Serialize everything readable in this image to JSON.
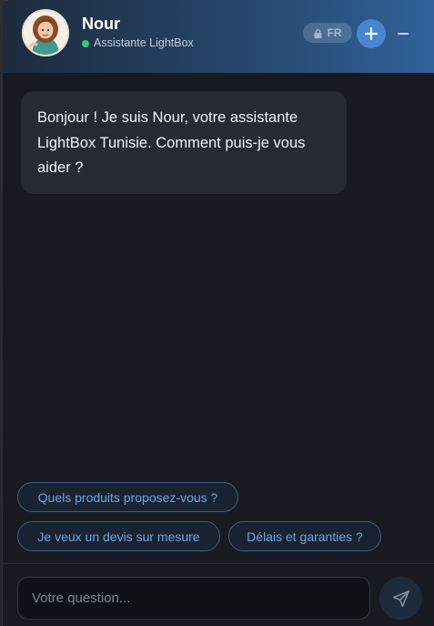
{
  "header": {
    "agent_name": "Nour",
    "agent_subtitle": "Assistante LightBox",
    "status_color": "#2ecc71",
    "language_badge": "FR",
    "new_chat_icon": "plus-icon",
    "minimize_icon": "minus-icon"
  },
  "messages": [
    {
      "sender": "bot",
      "text": "Bonjour ! Je suis Nour, votre assistante LightBox Tunisie. Comment puis-je vous aider ?"
    }
  ],
  "suggestions": [
    "Quels produits proposez-vous ?",
    "Je veux un devis sur mesure",
    "Délais et garanties ?"
  ],
  "composer": {
    "placeholder": "Votre question...",
    "value": "",
    "send_icon": "send-icon"
  },
  "colors": {
    "accent": "#4a86cf",
    "chip_text": "#6aa6e6",
    "background": "#171b21"
  }
}
